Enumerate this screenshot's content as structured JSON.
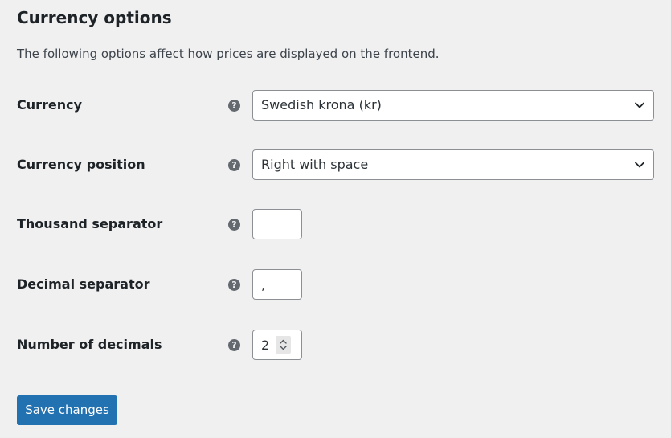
{
  "section": {
    "title": "Currency options",
    "description": "The following options affect how prices are displayed on the frontend."
  },
  "fields": {
    "currency": {
      "label": "Currency",
      "help": "?",
      "value": "Swedish krona (kr)"
    },
    "currency_position": {
      "label": "Currency position",
      "help": "?",
      "value": "Right with space"
    },
    "thousand_separator": {
      "label": "Thousand separator",
      "help": "?",
      "value": ""
    },
    "decimal_separator": {
      "label": "Decimal separator",
      "help": "?",
      "value": ","
    },
    "number_of_decimals": {
      "label": "Number of decimals",
      "help": "?",
      "value": "2"
    }
  },
  "actions": {
    "save_label": "Save changes"
  },
  "icons": {
    "help": "help-icon",
    "dropdown": "chevron-down-icon",
    "stepper": "stepper-icon"
  },
  "colors": {
    "primary": "#2271b1",
    "background": "#f0f0f1",
    "help_icon": "#646970",
    "input_border": "#8c8f94"
  }
}
